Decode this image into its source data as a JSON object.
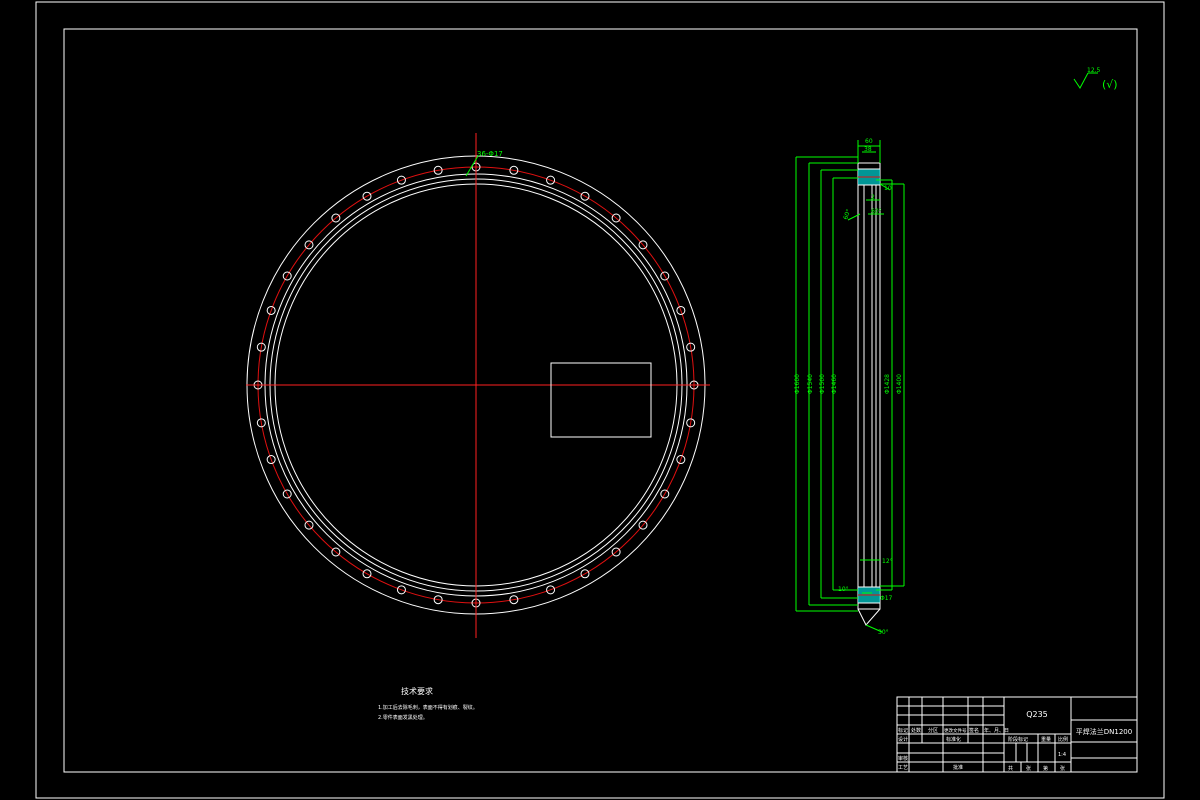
{
  "colors": {
    "background": "#000000",
    "outline": "#ffffff",
    "centerline": "#ff2020",
    "bolt_circle": "#e01010",
    "dimension": "#00ff00",
    "hatch": "#00c8c8"
  },
  "front_view": {
    "bolt_hole_count": 36,
    "callout": "36-Φ17"
  },
  "surface_finish": {
    "roughness": "12.5",
    "suffix": "(√)"
  },
  "side_view": {
    "dimensions": {
      "top_width": "60",
      "top_inner": "38",
      "right_a": "10",
      "right_b": "2",
      "angle_upper": "60°",
      "left_dia_1": "Φ1600",
      "left_dia_2": "Φ1540",
      "left_dia_3": "Φ1500",
      "left_dia_4": "Φ1460",
      "right_dia_1": "Φ1428",
      "right_dia_2": "Φ1400",
      "lower_a": "12°",
      "lower_b": "10°",
      "bottom_callout": "Φ17",
      "bottom_angle": "30°"
    }
  },
  "tech_notes": {
    "title": "技术要求",
    "lines": [
      "1.加工后去除毛刺，表面不得有划痕、裂纹。",
      "2.零件表面发黑处理。"
    ]
  },
  "title_block": {
    "material": "Q235",
    "part_name": "平焊法兰DN1200",
    "labels": {
      "mark": "标记",
      "count": "处数",
      "zone": "分区",
      "change_doc": "更改文件号",
      "signature": "签名",
      "date": "年、月、日",
      "design": "设计",
      "standardize": "标准化",
      "stage_mark": "阶段标记",
      "weight": "重量",
      "scale": "比例",
      "scale_value": "1:4",
      "review": "审核",
      "process": "工艺",
      "approve": "批准",
      "sheet_total": "共",
      "sheet_unit_a": "张",
      "sheet_no": "第",
      "sheet_unit_b": "张"
    }
  }
}
